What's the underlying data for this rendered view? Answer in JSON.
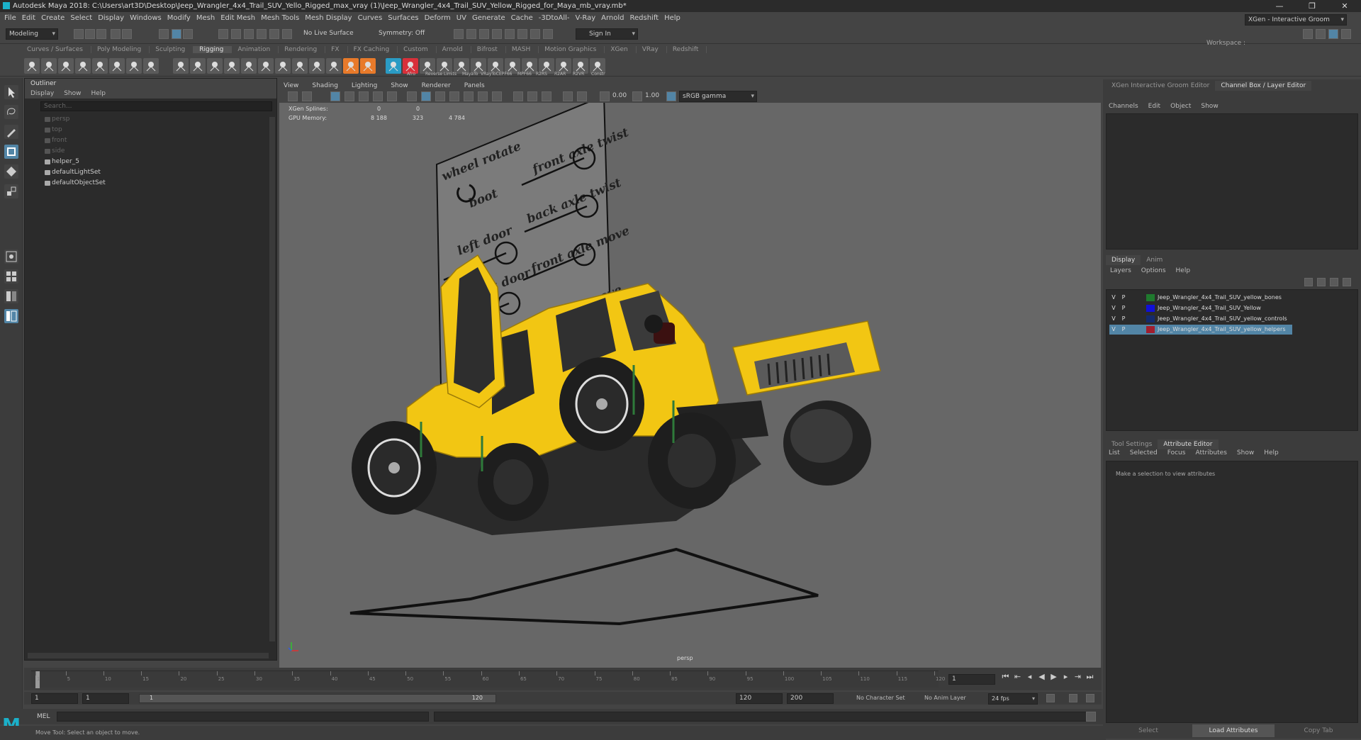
{
  "titlebar": {
    "title": "Autodesk Maya 2018: C:\\Users\\art3D\\Desktop\\Jeep_Wrangler_4x4_Trail_SUV_Yello_Rigged_max_vray (1)\\Jeep_Wrangler_4x4_Trail_SUV_Yellow_Rigged_for_Maya_mb_vray.mb*"
  },
  "menubar": [
    "File",
    "Edit",
    "Create",
    "Select",
    "Display",
    "Windows",
    "Modify",
    "Mesh",
    "Edit Mesh",
    "Mesh Tools",
    "Mesh Display",
    "Curves",
    "Surfaces",
    "Deform",
    "UV",
    "Generate",
    "Cache",
    "-3DtoAll-",
    "V-Ray",
    "Arnold",
    "Redshift",
    "Help"
  ],
  "status": {
    "mode": "Modeling",
    "live_surface": "No Live Surface",
    "symmetry": "Symmetry: Off",
    "sign_in": "Sign In",
    "workspace_label": "Workspace :",
    "workspace": "XGen - Interactive Groom"
  },
  "shelf_tabs": [
    "Curves / Surfaces",
    "Poly Modeling",
    "Sculpting",
    "Rigging",
    "Animation",
    "Rendering",
    "FX",
    "FX Caching",
    "Custom",
    "Arnold",
    "Bifrost",
    "MASH",
    "Motion Graphics",
    "XGen",
    "VRay",
    "Redshift"
  ],
  "shelf_active": "Rigging",
  "shelf_labels": [
    "Afro",
    "Reverse",
    "Limits",
    "MayaTo",
    "VRayToC",
    "EPF66",
    "MPF66",
    "R2RS",
    "R2AR",
    "R2VR",
    "Constr"
  ],
  "outliner": {
    "title": "Outliner",
    "menu": [
      "Display",
      "Show",
      "Help"
    ],
    "search_placeholder": "Search...",
    "items": [
      {
        "label": "persp",
        "dim": true
      },
      {
        "label": "top",
        "dim": true
      },
      {
        "label": "front",
        "dim": true
      },
      {
        "label": "side",
        "dim": true
      },
      {
        "label": "helper_5",
        "dim": false
      },
      {
        "label": "defaultLightSet",
        "dim": false
      },
      {
        "label": "defaultObjectSet",
        "dim": false
      }
    ]
  },
  "viewport": {
    "menu": [
      "View",
      "Shading",
      "Lighting",
      "Show",
      "Renderer",
      "Panels"
    ],
    "exposure": "0.00",
    "gamma": "1.00",
    "color_space": "sRGB gamma",
    "hud": [
      {
        "label": "XGen Splines:",
        "a": "0",
        "b": "0",
        "c": ""
      },
      {
        "label": "GPU Memory:",
        "a": "8 188",
        "b": "323",
        "c": "4 784"
      }
    ],
    "camera": "persp",
    "controls_text": [
      "wheel rotate",
      "boot",
      "left door",
      "right door",
      "front axle twist",
      "back axle twist",
      "front axle move",
      "back axle move"
    ]
  },
  "right": {
    "tabs_top": [
      "XGen Interactive Groom Editor",
      "Channel Box / Layer Editor"
    ],
    "channel_menu": [
      "Channels",
      "Edit",
      "Object",
      "Show"
    ],
    "display_tabs": [
      "Display",
      "Anim"
    ],
    "layer_menu": [
      "Layers",
      "Options",
      "Help"
    ],
    "layers": [
      {
        "v": "V",
        "p": "P",
        "color": "#1f7a2e",
        "name": "Jeep_Wrangler_4x4_Trail_SUV_yellow_bones",
        "selected": false
      },
      {
        "v": "V",
        "p": "P",
        "color": "#1010d8",
        "name": "Jeep_Wrangler_4x4_Trail_SUV_Yellow",
        "selected": false
      },
      {
        "v": "V",
        "p": "P",
        "color": "#142a6e",
        "name": "Jeep_Wrangler_4x4_Trail_SUV_yellow_controls",
        "selected": false
      },
      {
        "v": "V",
        "p": "P",
        "color": "#a01e2e",
        "name": "Jeep_Wrangler_4x4_Trail_SUV_yellow_helpers",
        "selected": true
      }
    ],
    "attr_tabs": [
      "Tool Settings",
      "Attribute Editor"
    ],
    "attr_menu": [
      "List",
      "Selected",
      "Focus",
      "Attributes",
      "Show",
      "Help"
    ],
    "attr_msg": "Make a selection to view attributes",
    "bottom_buttons": [
      "Select",
      "Load Attributes",
      "Copy Tab"
    ]
  },
  "timeline": {
    "ticks": [
      "1",
      "5",
      "10",
      "15",
      "20",
      "25",
      "30",
      "35",
      "40",
      "45",
      "50",
      "55",
      "60",
      "65",
      "70",
      "75",
      "80",
      "85",
      "90",
      "95",
      "100",
      "105",
      "110",
      "115",
      "120"
    ],
    "current": "1"
  },
  "range": {
    "start": "1",
    "start2": "1",
    "slider_start": "1",
    "slider_end": "120",
    "end": "120",
    "end2": "200",
    "character": "No Character Set",
    "anim_layer": "No Anim Layer",
    "fps": "24 fps"
  },
  "mel": {
    "label": "MEL"
  },
  "help": "Move Tool: Select an object to move.",
  "colors": {
    "jeep_yellow": "#f2c613",
    "layer_selected": "#5285a6",
    "maya_logo": "#1bb0c9"
  }
}
